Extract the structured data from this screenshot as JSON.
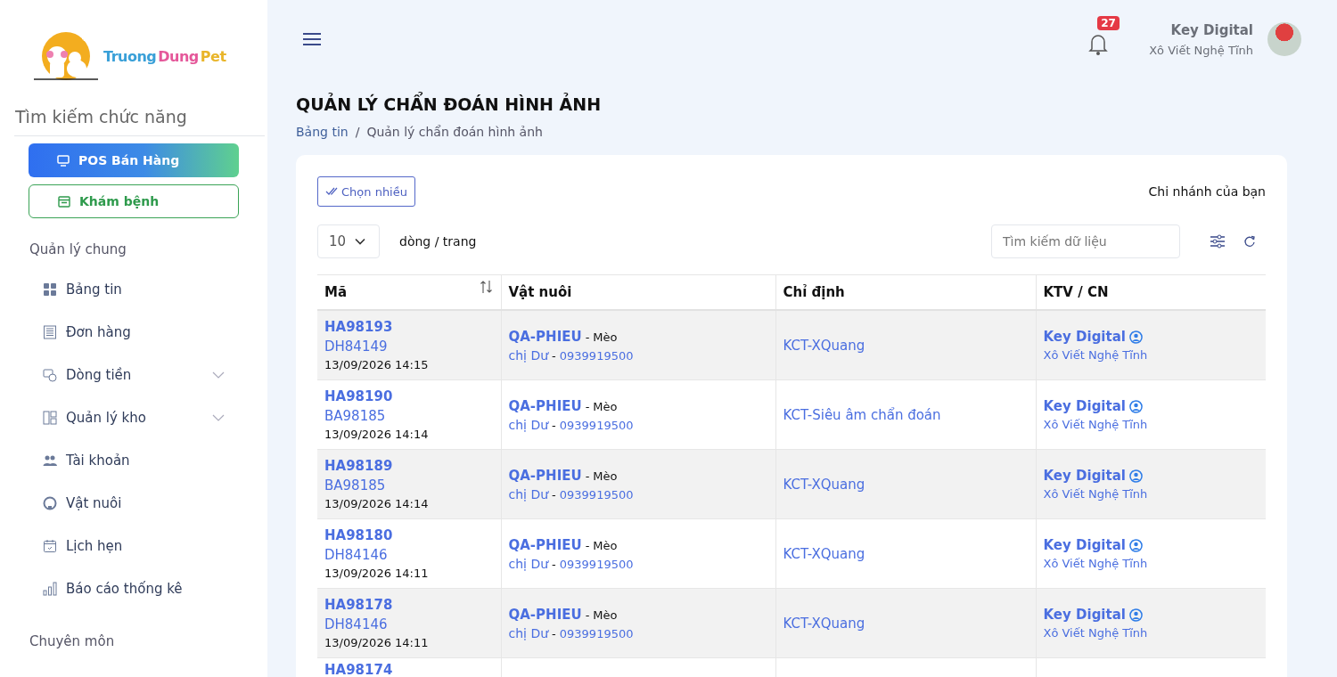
{
  "sidebar": {
    "logo": {
      "words": [
        "Truong",
        "Dung",
        "Pet"
      ]
    },
    "search": {
      "placeholder": "Tìm kiếm chức năng"
    },
    "pos_button": "POS Bán Hàng",
    "exam_button": "Khám bệnh",
    "sections": [
      {
        "title": "Quản lý chung",
        "items": [
          {
            "label": "Bảng tin",
            "kind": "link"
          },
          {
            "label": "Đơn hàng",
            "kind": "link"
          },
          {
            "label": "Dòng tiền",
            "kind": "group"
          },
          {
            "label": "Quản lý kho",
            "kind": "group"
          },
          {
            "label": "Tài khoản",
            "kind": "link"
          },
          {
            "label": "Vật nuôi",
            "kind": "link"
          },
          {
            "label": "Lịch hẹn",
            "kind": "link"
          },
          {
            "label": "Báo cáo thống kê",
            "kind": "link"
          }
        ]
      },
      {
        "title": "Chuyên môn"
      }
    ]
  },
  "header": {
    "notification_count": "27",
    "user": {
      "name": "Key Digital",
      "branch": "Xô Viết Nghệ Tĩnh"
    }
  },
  "page": {
    "title": "QUẢN LÝ CHẨN ĐOÁN HÌNH ẢNH",
    "breadcrumb": [
      "Bảng tin",
      "Quản lý chẩn đoán hình ảnh"
    ],
    "breadcrumb_separator": "/"
  },
  "toolbar": {
    "multi_select": "Chọn nhiều",
    "branch_label": "Chi nhánh của bạn",
    "page_size": "10",
    "page_size_label": "dòng / trang",
    "search": {
      "placeholder": "Tìm kiếm dữ liệu"
    }
  },
  "table": {
    "columns": [
      "Mã",
      "Vật nuôi",
      "Chỉ định",
      "KTV / CN"
    ],
    "rows": [
      {
        "code": "HA98193",
        "ref": "DH84149",
        "time": "13/09/2026 14:15",
        "pet": "QA-PHIEU",
        "pet_separator": "-",
        "species": "Mèo",
        "owner_separator": "-",
        "owner": "chị Dư",
        "phone": "0939919500",
        "service": "KCT-XQuang",
        "tech": "Key Digital",
        "branch": "Xô Viết Nghệ Tĩnh"
      },
      {
        "code": "HA98190",
        "ref": "BA98185",
        "time": "13/09/2026 14:14",
        "pet": "QA-PHIEU",
        "pet_separator": "-",
        "species": "Mèo",
        "owner_separator": "-",
        "owner": "chị Dư",
        "phone": "0939919500",
        "service": "KCT-Siêu âm chẩn đoán",
        "tech": "Key Digital",
        "branch": "Xô Viết Nghệ Tĩnh"
      },
      {
        "code": "HA98189",
        "ref": "BA98185",
        "time": "13/09/2026 14:14",
        "pet": "QA-PHIEU",
        "pet_separator": "-",
        "species": "Mèo",
        "owner_separator": "-",
        "owner": "chị Dư",
        "phone": "0939919500",
        "service": "KCT-XQuang",
        "tech": "Key Digital",
        "branch": "Xô Viết Nghệ Tĩnh"
      },
      {
        "code": "HA98180",
        "ref": "DH84146",
        "time": "13/09/2026 14:11",
        "pet": "QA-PHIEU",
        "pet_separator": "-",
        "species": "Mèo",
        "owner_separator": "-",
        "owner": "chị Dư",
        "phone": "0939919500",
        "service": "KCT-XQuang",
        "tech": "Key Digital",
        "branch": "Xô Viết Nghệ Tĩnh"
      },
      {
        "code": "HA98178",
        "ref": "DH84146",
        "time": "13/09/2026 14:11",
        "pet": "QA-PHIEU",
        "pet_separator": "-",
        "species": "Mèo",
        "owner_separator": "-",
        "owner": "chị Dư",
        "phone": "0939919500",
        "service": "KCT-XQuang",
        "tech": "Key Digital",
        "branch": "Xô Viết Nghệ Tĩnh"
      },
      {
        "code": "HA98174"
      }
    ]
  }
}
